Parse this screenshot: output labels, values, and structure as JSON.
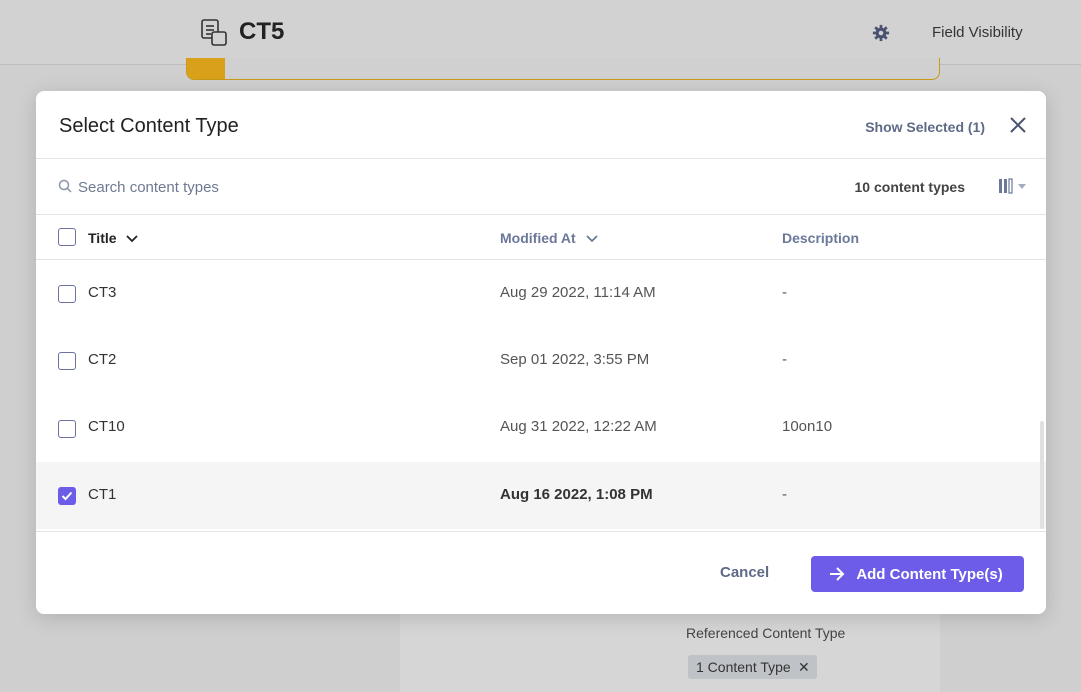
{
  "background": {
    "title": "CT5",
    "field_visibility": "Field Visibility",
    "progress_fraction": 0.05,
    "referenced_label": "Referenced Content Type",
    "referenced_chip": "1 Content Type"
  },
  "modal": {
    "title": "Select Content Type",
    "show_selected": "Show Selected (1)",
    "search_placeholder": "Search content types",
    "count": "10 content types",
    "columns": {
      "title": "Title",
      "modified": "Modified At",
      "description": "Description"
    },
    "rows": [
      {
        "title": "CT3",
        "modified": "Aug 29 2022, 11:14 AM",
        "description": "-",
        "checked": false
      },
      {
        "title": "CT2",
        "modified": "Sep 01 2022, 3:55 PM",
        "description": "-",
        "checked": false
      },
      {
        "title": "CT10",
        "modified": "Aug 31 2022, 12:22 AM",
        "description": "10on10",
        "checked": false
      },
      {
        "title": "CT1",
        "modified": "Aug 16 2022, 1:08 PM",
        "description": "-",
        "checked": true
      }
    ],
    "cancel_label": "Cancel",
    "add_label": "Add Content Type(s)"
  },
  "colors": {
    "accent": "#6c5ce7",
    "progress": "#d9a11a"
  }
}
